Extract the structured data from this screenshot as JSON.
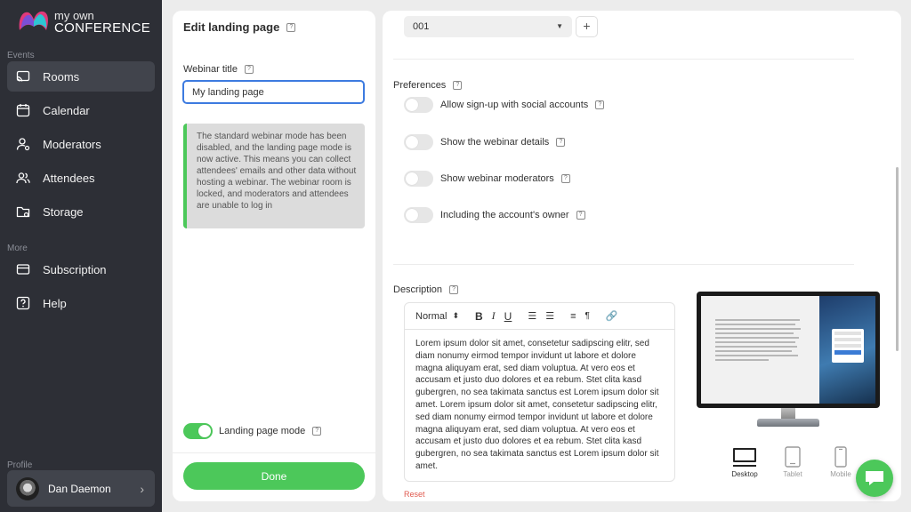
{
  "brand": {
    "line1": "my own",
    "line2": "CONFERENCE"
  },
  "sidebar": {
    "section_events": "Events",
    "section_more": "More",
    "section_profile": "Profile",
    "items": [
      {
        "label": "Rooms",
        "icon": "cast-icon",
        "active": true
      },
      {
        "label": "Calendar",
        "icon": "calendar-icon"
      },
      {
        "label": "Moderators",
        "icon": "moderator-icon"
      },
      {
        "label": "Attendees",
        "icon": "attendees-icon"
      },
      {
        "label": "Storage",
        "icon": "folder-icon"
      }
    ],
    "more_items": [
      {
        "label": "Subscription",
        "icon": "card-icon"
      },
      {
        "label": "Help",
        "icon": "help-icon"
      }
    ],
    "profile_name": "Dan Daemon"
  },
  "left_panel": {
    "title": "Edit landing page",
    "webinar_title_label": "Webinar title",
    "webinar_title_value": "My landing page",
    "notice": "The standard webinar mode has been disabled, and the landing page mode is now active. This means you can collect attendees' emails and other data without hosting a webinar. The webinar room is locked, and moderators and attendees are unable to log in",
    "landing_mode_label": "Landing page mode",
    "landing_mode_on": true,
    "done_label": "Done"
  },
  "right_panel": {
    "select_value": "001",
    "plus_label": "+",
    "preferences_label": "Preferences",
    "preferences": [
      {
        "label": "Allow sign-up with social accounts",
        "on": false
      },
      {
        "label": "Show the webinar details",
        "on": false
      },
      {
        "label": "Show webinar moderators",
        "on": false
      },
      {
        "label": "Including the account's owner",
        "on": false
      }
    ],
    "description_label": "Description",
    "editor": {
      "format": "Normal",
      "body": "Lorem ipsum dolor sit amet, consetetur sadipscing elitr, sed diam nonumy eirmod tempor invidunt ut labore et dolore magna aliquyam erat, sed diam voluptua. At vero eos et accusam et justo duo dolores et ea rebum. Stet clita kasd gubergren, no sea takimata sanctus est Lorem ipsum dolor sit amet. Lorem ipsum dolor sit amet, consetetur sadipscing elitr, sed diam nonumy eirmod tempor invidunt ut labore et dolore magna aliquyam erat, sed diam voluptua. At vero eos et accusam et justo duo dolores et ea rebum. Stet clita kasd gubergren, no sea takimata sanctus est Lorem ipsum dolor sit amet."
    },
    "reset_label": "Reset",
    "devices": [
      {
        "label": "Desktop",
        "active": true
      },
      {
        "label": "Tablet",
        "active": false
      },
      {
        "label": "Mobile",
        "active": false
      }
    ]
  },
  "colors": {
    "sidebar": "#2d2f36",
    "accent_green": "#4cc85a",
    "focus_blue": "#3d7be0",
    "reset_red": "#e05a4f"
  }
}
